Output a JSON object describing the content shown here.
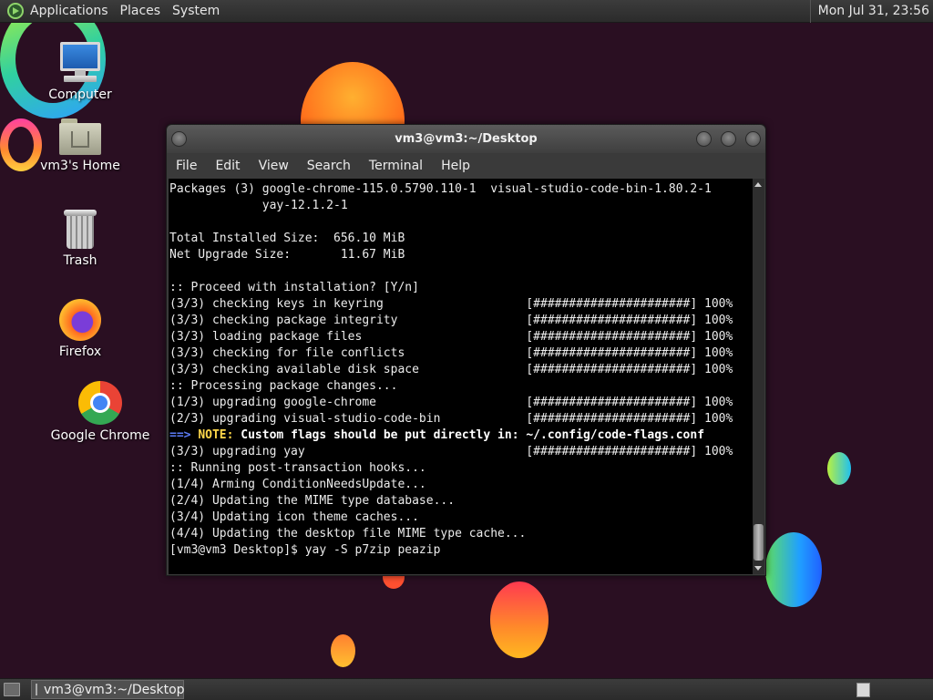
{
  "top_panel": {
    "menus": [
      "Applications",
      "Places",
      "System"
    ],
    "clock": "Mon Jul 31, 23:56"
  },
  "desktop_icons": [
    {
      "label": "Computer",
      "icon": "computer-icon"
    },
    {
      "label": "vm3's Home",
      "icon": "home-folder-icon"
    },
    {
      "label": "Trash",
      "icon": "trash-icon"
    },
    {
      "label": "Firefox",
      "icon": "firefox-icon"
    },
    {
      "label": "Google Chrome",
      "icon": "chrome-icon"
    }
  ],
  "terminal": {
    "title": "vm3@vm3:~/Desktop",
    "menu": [
      "File",
      "Edit",
      "View",
      "Search",
      "Terminal",
      "Help"
    ],
    "lines": [
      "Packages (3) google-chrome-115.0.5790.110-1  visual-studio-code-bin-1.80.2-1",
      "             yay-12.1.2-1",
      "",
      "Total Installed Size:  656.10 MiB",
      "Net Upgrade Size:       11.67 MiB",
      "",
      ":: Proceed with installation? [Y/n]",
      "(3/3) checking keys in keyring                    [######################] 100%",
      "(3/3) checking package integrity                  [######################] 100%",
      "(3/3) loading package files                       [######################] 100%",
      "(3/3) checking for file conflicts                 [######################] 100%",
      "(3/3) checking available disk space               [######################] 100%",
      ":: Processing package changes...",
      "(1/3) upgrading google-chrome                     [######################] 100%",
      "(2/3) upgrading visual-studio-code-bin            [######################] 100%"
    ],
    "note": {
      "arrow": "==>",
      "label": "NOTE:",
      "text": "Custom flags should be put directly in: ~/.config/code-flags.conf"
    },
    "lines_after": [
      "(3/3) upgrading yay                               [######################] 100%",
      ":: Running post-transaction hooks...",
      "(1/4) Arming ConditionNeedsUpdate...",
      "(2/4) Updating the MIME type database...",
      "(3/4) Updating icon theme caches...",
      "(4/4) Updating the desktop file MIME type cache...",
      "[vm3@vm3 Desktop]$ yay -S p7zip peazip"
    ]
  },
  "taskbar": {
    "task_label": "vm3@vm3:~/Desktop"
  },
  "colors": {
    "wallpaper": "#2a0f22",
    "note_arrow": "#5b7cf7",
    "note_label": "#ffd84a"
  }
}
